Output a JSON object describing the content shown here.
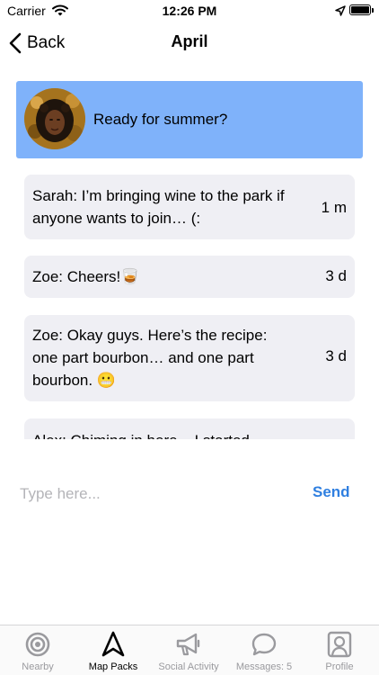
{
  "status_bar": {
    "carrier": "Carrier",
    "time": "12:26 PM"
  },
  "nav": {
    "back_label": "Back",
    "title": "April"
  },
  "pack": {
    "title": "Ready for summer?"
  },
  "messages": [
    {
      "text": "Sarah: I’m bringing wine to the park if anyone wants to join… (:",
      "time": "1 m"
    },
    {
      "text": "Zoe: Cheers!🥃",
      "time": "3 d"
    },
    {
      "text": "Zoe: Okay guys. Here’s the recipe: one part bourbon… and one part bourbon. 😬",
      "time": "3 d"
    },
    {
      "text": "Alex: Chiming in here... I started",
      "time": ""
    }
  ],
  "compose": {
    "placeholder": "Type here...",
    "send_label": "Send"
  },
  "tabs": [
    {
      "label": "Nearby",
      "icon": "nearby-icon",
      "active": false
    },
    {
      "label": "Map Packs",
      "icon": "map-packs-icon",
      "active": true
    },
    {
      "label": "Social Activity",
      "icon": "megaphone-icon",
      "active": false
    },
    {
      "label": "Messages: 5",
      "icon": "chat-bubble-icon",
      "active": false
    },
    {
      "label": "Profile",
      "icon": "profile-icon",
      "active": false
    }
  ],
  "colors": {
    "banner": "#7fb2fa",
    "message_bubble": "#efeff4",
    "accent": "#2f7fe0",
    "inactive_tab": "#9a9a9e"
  }
}
